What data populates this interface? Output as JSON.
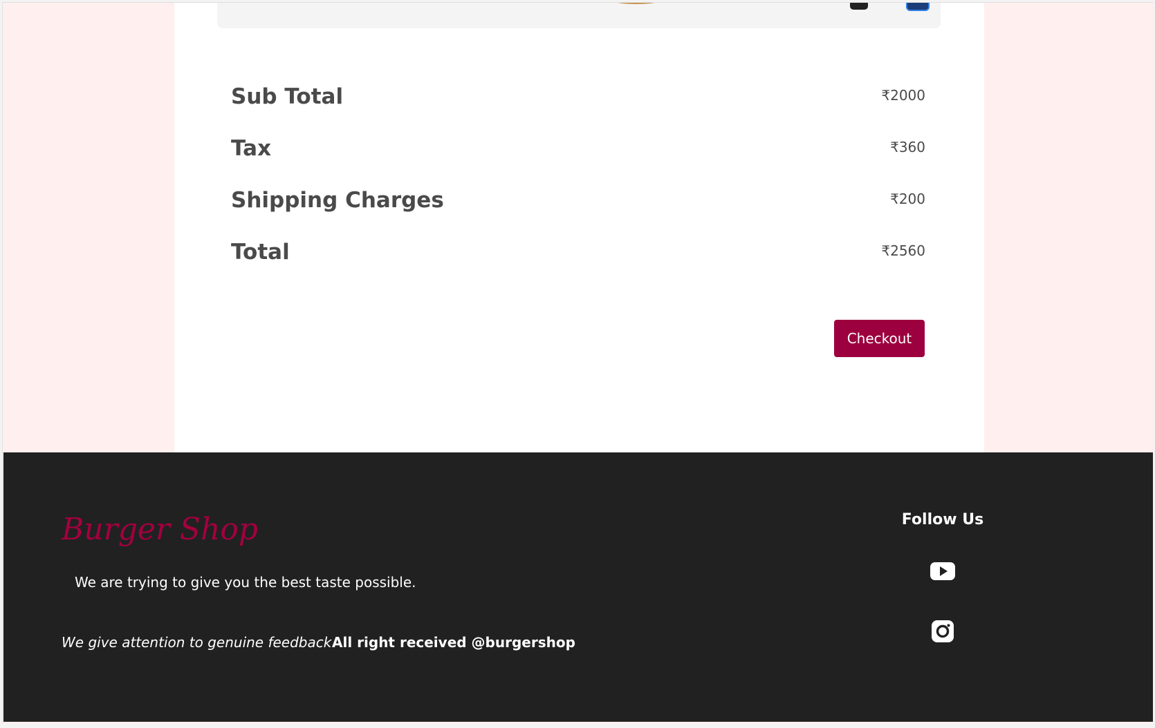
{
  "summary": {
    "rows": [
      {
        "label": "Sub Total",
        "value": "₹2000"
      },
      {
        "label": "Tax",
        "value": "₹360"
      },
      {
        "label": "Shipping Charges",
        "value": "₹200"
      },
      {
        "label": "Total",
        "value": "₹2560"
      }
    ],
    "checkout_label": "Checkout"
  },
  "footer": {
    "brand": "Burger Shop",
    "tagline": "We are trying to give you the best taste possible.",
    "feedback": "We give attention to genuine feedback.",
    "rights": "All right received @burgershop",
    "follow_title": "Follow Us",
    "social_icons": [
      "youtube-icon",
      "instagram-icon"
    ]
  },
  "colors": {
    "accent": "#9c003e",
    "page_background": "#ffefef",
    "footer_background": "#212121",
    "text": "#4a4a4a"
  }
}
